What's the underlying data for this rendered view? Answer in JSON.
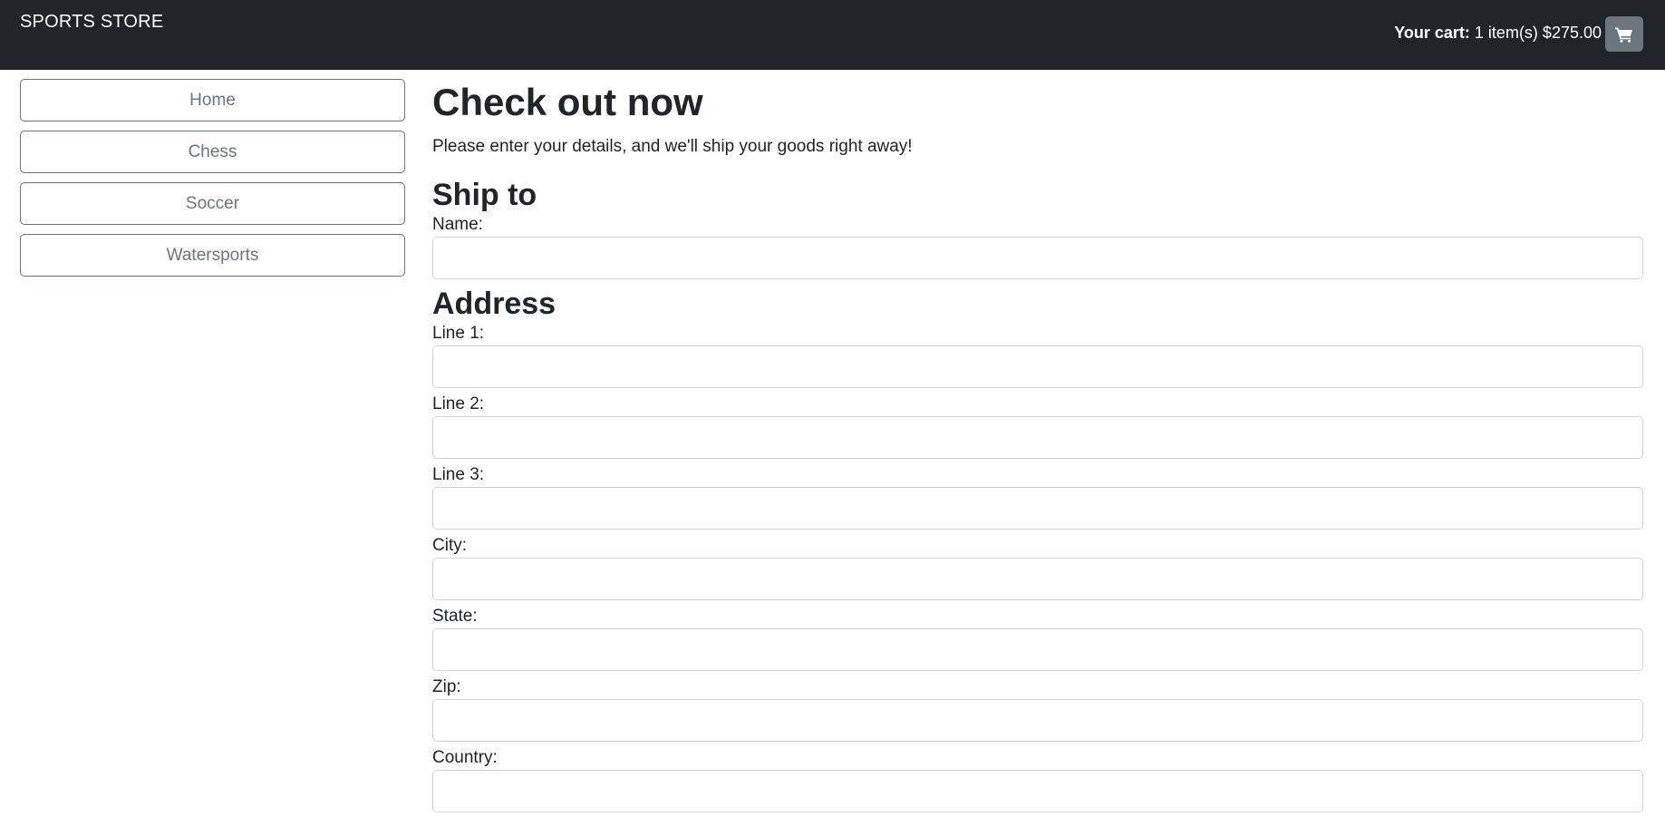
{
  "navbar": {
    "brand": "SPORTS STORE",
    "cart_label": "Your cart:",
    "cart_summary": "1 item(s) $275.00",
    "cart_icon": "shopping-cart-icon"
  },
  "sidebar": {
    "categories": [
      {
        "label": "Home"
      },
      {
        "label": "Chess"
      },
      {
        "label": "Soccer"
      },
      {
        "label": "Watersports"
      }
    ]
  },
  "main": {
    "title": "Check out now",
    "intro": "Please enter your details, and we'll ship your goods right away!",
    "ship_to_heading": "Ship to",
    "address_heading": "Address",
    "fields": {
      "name": {
        "label": "Name:",
        "value": ""
      },
      "line1": {
        "label": "Line 1:",
        "value": ""
      },
      "line2": {
        "label": "Line 2:",
        "value": ""
      },
      "line3": {
        "label": "Line 3:",
        "value": ""
      },
      "city": {
        "label": "City:",
        "value": ""
      },
      "state": {
        "label": "State:",
        "value": ""
      },
      "zip": {
        "label": "Zip:",
        "value": ""
      },
      "country": {
        "label": "Country:",
        "value": ""
      }
    }
  },
  "colors": {
    "navbar_bg": "#212529",
    "cart_button_bg": "#6c757d",
    "category_border": "#6c757d",
    "input_border": "#ced4da"
  }
}
